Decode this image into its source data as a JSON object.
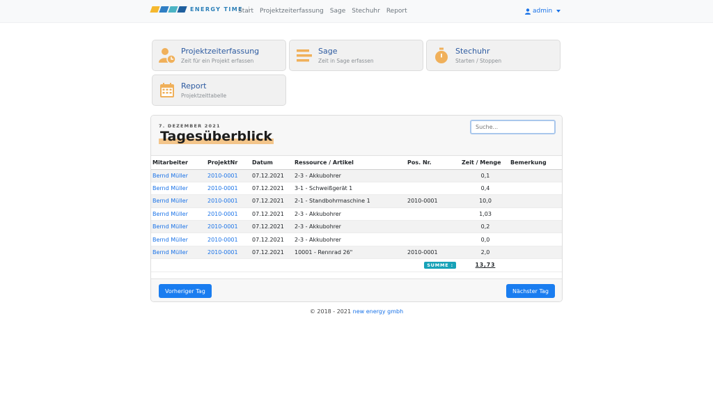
{
  "nav": {
    "brand": "ENERGY TIME",
    "logo_colors": [
      "#f5b82e",
      "#2f7ec4",
      "#4cb4c4",
      "#1f5f9e"
    ],
    "links": [
      "Start",
      "Projektzeiterfassung",
      "Sage",
      "Stechuhr",
      "Report"
    ],
    "user": "admin",
    "user_icon": "user-icon"
  },
  "tiles": [
    {
      "title": "Projektzeiterfassung",
      "subtitle": "Zeit für ein Projekt erfassen",
      "icon": "user-clock-icon"
    },
    {
      "title": "Sage",
      "subtitle": "Zeit in Sage erfassen",
      "icon": "list-icon"
    },
    {
      "title": "Stechuhr",
      "subtitle": "Starten / Stoppen",
      "icon": "stopwatch-icon"
    },
    {
      "title": "Report",
      "subtitle": "Projektzeittabelle",
      "icon": "calendar-icon"
    }
  ],
  "accent_color": "#f0b05a",
  "overview": {
    "date": "7. DEZEMBER 2021",
    "title": "Tagesüberblick",
    "search_placeholder": "Suche...",
    "columns": [
      "Mitarbeiter",
      "ProjektNr",
      "Datum",
      "Ressource / Artikel",
      "Pos. Nr.",
      "Zeit / Menge",
      "Bemerkung"
    ],
    "rows": [
      [
        "Bernd Müller",
        "2010-0001",
        "07.12.2021",
        "2-3 - Akkubohrer",
        "",
        "0,1",
        ""
      ],
      [
        "Bernd Müller",
        "2010-0001",
        "07.12.2021",
        "3-1 - Schweißgerät 1",
        "",
        "0,4",
        ""
      ],
      [
        "Bernd Müller",
        "2010-0001",
        "07.12.2021",
        "2-1 - Standbohrmaschine 1",
        "2010-0001",
        "10,0",
        ""
      ],
      [
        "Bernd Müller",
        "2010-0001",
        "07.12.2021",
        "2-3 - Akkubohrer",
        "",
        "1,03",
        ""
      ],
      [
        "Bernd Müller",
        "2010-0001",
        "07.12.2021",
        "2-3 - Akkubohrer",
        "",
        "0,2",
        ""
      ],
      [
        "Bernd Müller",
        "2010-0001",
        "07.12.2021",
        "2-3 - Akkubohrer",
        "",
        "0,0",
        ""
      ],
      [
        "Bernd Müller",
        "2010-0001",
        "07.12.2021",
        "10001 - Rennrad 26\"",
        "2010-0001",
        "2,0",
        ""
      ]
    ],
    "sum_label": "SUMME :",
    "sum_value": "13,73",
    "prev_button": "Vorheriger Tag",
    "next_button": "Nächster Tag"
  },
  "footer": {
    "text": "© 2018 - 2021",
    "company": "new energy gmbh"
  }
}
